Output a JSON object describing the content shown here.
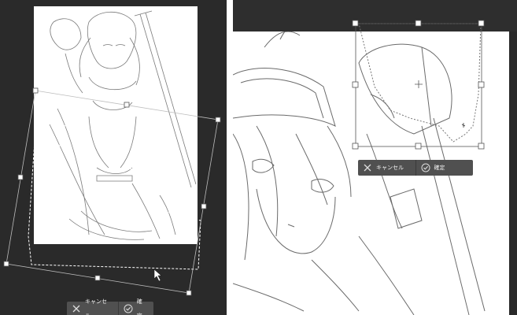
{
  "left": {
    "action_bar": {
      "cancel_label": "キャンセル",
      "confirm_label": "確定"
    }
  },
  "right": {
    "action_bar": {
      "cancel_label": "キャンセル",
      "confirm_label": "確定"
    }
  },
  "icons": {
    "cancel": "close-icon",
    "confirm": "check-circle-icon"
  },
  "colors": {
    "workspace": "#2a2a2a",
    "action_bar": "#505050",
    "handle_stroke": "#555555"
  }
}
